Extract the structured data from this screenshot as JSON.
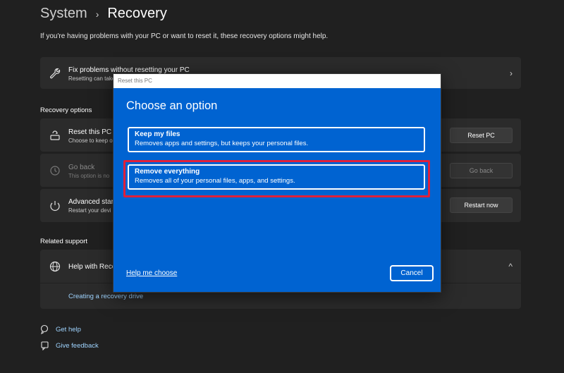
{
  "breadcrumb": {
    "parent": "System",
    "separator": "›",
    "current": "Recovery"
  },
  "subtitle": "If you're having problems with your PC or want to reset it, these recovery options might help.",
  "fix_card": {
    "title": "Fix problems without resetting your PC",
    "desc": "Resetting can take",
    "chevron": "›"
  },
  "recovery_options_label": "Recovery options",
  "reset_card": {
    "title": "Reset this PC",
    "desc": "Choose to keep o",
    "button": "Reset PC"
  },
  "goback_card": {
    "title": "Go back",
    "desc": "This option is no",
    "button": "Go back"
  },
  "advanced_card": {
    "title": "Advanced start",
    "desc": "Restart your devi",
    "button": "Restart now"
  },
  "related_support_label": "Related support",
  "help_card": {
    "title": "Help with Reco",
    "chevron": "^",
    "link": "Creating a recovery drive"
  },
  "footer": {
    "get_help": "Get help",
    "give_feedback": "Give feedback"
  },
  "dialog": {
    "titlebar": "Reset this PC",
    "heading": "Choose an option",
    "options": [
      {
        "title": "Keep my files",
        "desc": "Removes apps and settings, but keeps your personal files."
      },
      {
        "title": "Remove everything",
        "desc": "Removes all of your personal files, apps, and settings."
      }
    ],
    "help_link": "Help me choose",
    "cancel": "Cancel"
  },
  "colors": {
    "dialog_bg": "#0063d1",
    "highlight": "#e0203a",
    "page_bg": "#202020",
    "card_bg": "#2b2b2b"
  }
}
